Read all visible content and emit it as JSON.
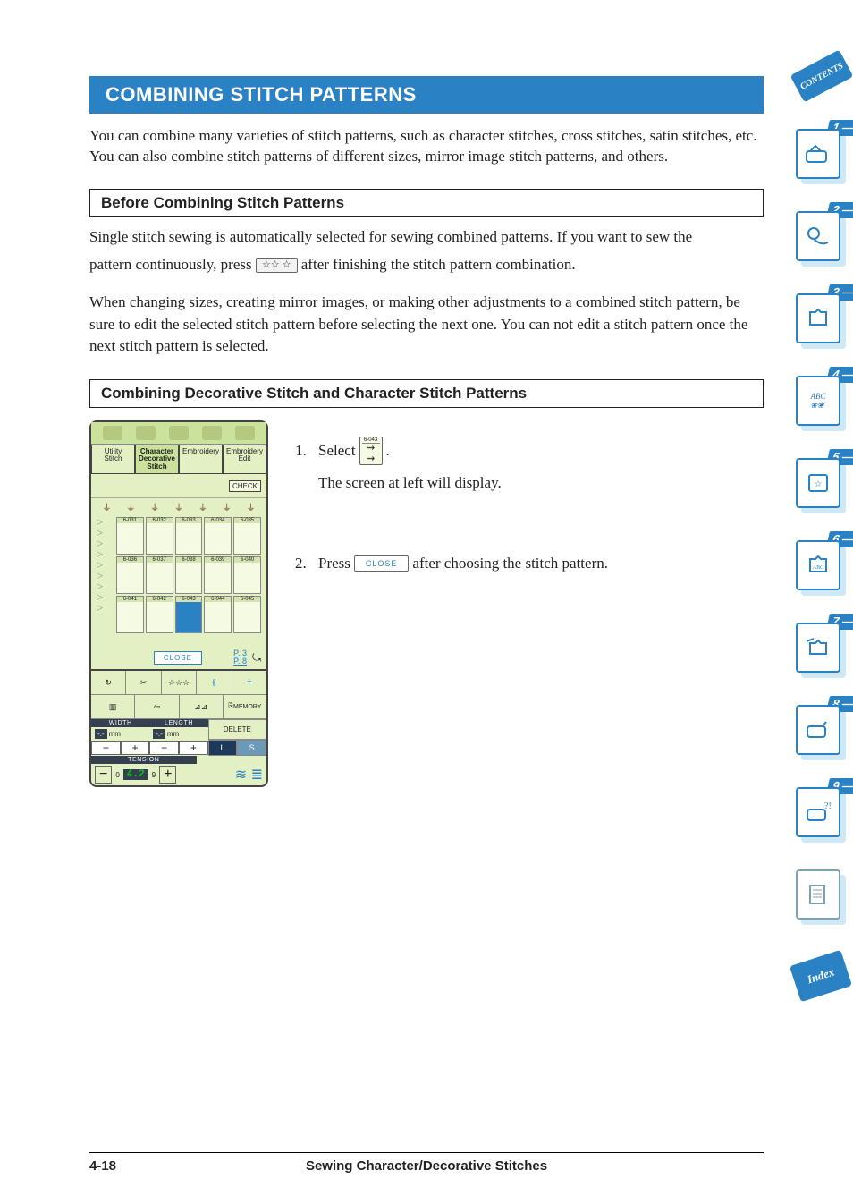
{
  "heading": "COMBINING STITCH PATTERNS",
  "intro": "You can combine many varieties of stitch patterns, such as character stitches, cross stitches, satin stitches, etc.  You can also combine stitch patterns of different sizes, mirror image stitch patterns, and others.",
  "sub1": "Before Combining Stitch Patterns",
  "body1a": "Single stitch sewing is automatically selected for sewing combined patterns. If you want to sew the",
  "body1b_pre": "pattern continuously, press ",
  "body1b_btn": "☆☆ ☆",
  "body1b_post": " after finishing the stitch pattern combination.",
  "body2": "When changing sizes, creating mirror images, or making other adjustments to a combined stitch pattern, be sure to edit the selected stitch pattern before selecting the next one. You can not edit a stitch pattern once the next stitch pattern is selected.",
  "sub2": "Combining Decorative Stitch and Character Stitch Patterns",
  "lcd": {
    "tabs": [
      "Utility\nStitch",
      "Character\nDecorative\nStitch",
      "Embroidery",
      "Embroidery\nEdit"
    ],
    "check": "CHECK",
    "grid_ids_r1": [
      "6-031",
      "6-032",
      "6-033",
      "6-034",
      "6-035"
    ],
    "grid_ids_r2": [
      "6-036",
      "6-037",
      "6-038",
      "6-039",
      "6-040"
    ],
    "grid_ids_r3": [
      "6-041",
      "6-042",
      "6-043",
      "6-044",
      "6-045"
    ],
    "close": "CLOSE",
    "page_top": "P.  3",
    "page_bot": "P.  8",
    "memory": "MEMORY",
    "delete": "DELETE",
    "width_label": "WIDTH",
    "length_label": "LENGTH",
    "mm": "mm",
    "ls_l": "L",
    "ls_s": "S",
    "tension_label": "TENSION",
    "tension_lo": "0",
    "tension_val": "4.2",
    "tension_hi": "9"
  },
  "steps": {
    "s1_num": "1.",
    "s1_verb": "Select",
    "s1_btn_id": "6-043",
    "s1_post": ".",
    "s1_follow": "The screen at left will display.",
    "s2_num": "2.",
    "s2_verb": "Press",
    "s2_btn": "CLOSE",
    "s2_post": " after choosing the stitch pattern."
  },
  "footer": {
    "left": "4-18",
    "center": "Sewing Character/Decorative Stitches"
  },
  "sidetabs": {
    "contents": "CONTENTS",
    "t1": "1 —",
    "t2": "2 —",
    "t3": "3 —",
    "t4": "4 —",
    "t5": "5 —",
    "t6": "6 —",
    "t7": "7 —",
    "t8": "8 —",
    "t9": "9 —",
    "index": "Index"
  }
}
